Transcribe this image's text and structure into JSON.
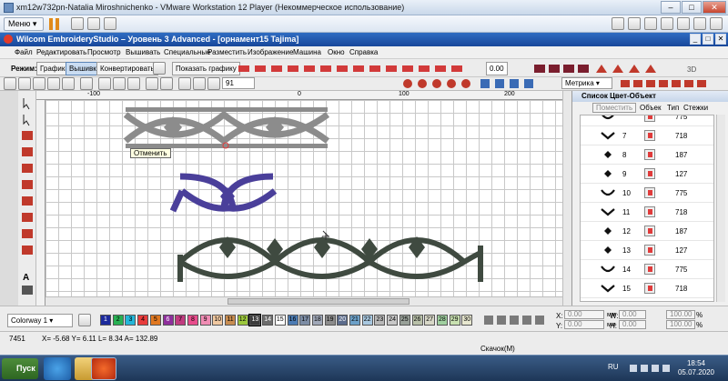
{
  "vmware": {
    "title": "xm12w732pn-Natalia Miroshnichenko - VMware Workstation 12 Player (Некоммерческое использование)",
    "menu_label": "Меню"
  },
  "app": {
    "title": "Wilcom EmbroideryStudio – Уровень 3 Advanced - [орнамент15      Tajima]"
  },
  "menu": {
    "items": [
      "Файл",
      "Редактировать",
      "Просмотр",
      "Вышивать",
      "Специальные",
      "Разместить",
      "Изображение",
      "Машина",
      "Окно",
      "Справка"
    ]
  },
  "toolbar1": {
    "mode_label": "Режим:",
    "mode_graphic": "Графика",
    "mode_embroidery": "Вышивка",
    "convert": "Конвертировать",
    "show_graphic": "Показать графику",
    "value": "0.00",
    "num_3d": "3D"
  },
  "toolbar2": {
    "zoom": "91",
    "units": "Метрика"
  },
  "rulers": {
    "top_labels": [
      "-100",
      "0",
      "100",
      "200"
    ]
  },
  "tooltip": "Отменить",
  "panel": {
    "title": "Список Цвет-Объект",
    "apply_button": "Поместить",
    "headers": [
      "Объек",
      "Тип",
      "Стежки"
    ],
    "rows": [
      {
        "num": "",
        "stitches": "775",
        "shape": "arc"
      },
      {
        "num": "7",
        "stitches": "718",
        "shape": "vee"
      },
      {
        "num": "8",
        "stitches": "187",
        "shape": "dot"
      },
      {
        "num": "9",
        "stitches": "127",
        "shape": "dot"
      },
      {
        "num": "10",
        "stitches": "775",
        "shape": "arc"
      },
      {
        "num": "11",
        "stitches": "718",
        "shape": "vee"
      },
      {
        "num": "12",
        "stitches": "187",
        "shape": "dot"
      },
      {
        "num": "13",
        "stitches": "127",
        "shape": "dot"
      },
      {
        "num": "14",
        "stitches": "775",
        "shape": "arc"
      },
      {
        "num": "15",
        "stitches": "718",
        "shape": "vee"
      }
    ]
  },
  "colorbar": {
    "colorway": "Colorway 1",
    "swatches": [
      {
        "n": "1",
        "c": "#1c2a9c"
      },
      {
        "n": "2",
        "c": "#28b052"
      },
      {
        "n": "3",
        "c": "#24b6d8"
      },
      {
        "n": "4",
        "c": "#e83c3c"
      },
      {
        "n": "5",
        "c": "#e07820"
      },
      {
        "n": "6",
        "c": "#8e2f9c"
      },
      {
        "n": "7",
        "c": "#c03c80"
      },
      {
        "n": "8",
        "c": "#e84c8c"
      },
      {
        "n": "9",
        "c": "#f08cb4"
      },
      {
        "n": "10",
        "c": "#f0c8a0"
      },
      {
        "n": "11",
        "c": "#c88c50"
      },
      {
        "n": "12",
        "c": "#9cc83c"
      },
      {
        "n": "13",
        "c": "#3c3c3c"
      },
      {
        "n": "14",
        "c": "#6c6c6c"
      },
      {
        "n": "15",
        "c": "#ffffff"
      },
      {
        "n": "16",
        "c": "#4c7cb4"
      },
      {
        "n": "17",
        "c": "#7c8ca4"
      },
      {
        "n": "18",
        "c": "#a0a8b8"
      },
      {
        "n": "19",
        "c": "#8c8c8c"
      },
      {
        "n": "20",
        "c": "#5c6c8c"
      },
      {
        "n": "21",
        "c": "#6ca0c8"
      },
      {
        "n": "22",
        "c": "#a8c8e0"
      },
      {
        "n": "23",
        "c": "#b8b8b8"
      },
      {
        "n": "24",
        "c": "#c8c8c8"
      },
      {
        "n": "25",
        "c": "#98a098"
      },
      {
        "n": "26",
        "c": "#b8c0a8"
      },
      {
        "n": "27",
        "c": "#d8d8c8"
      },
      {
        "n": "28",
        "c": "#a0d0a0"
      },
      {
        "n": "29",
        "c": "#c8e0b0"
      },
      {
        "n": "30",
        "c": "#e8e8d0"
      }
    ],
    "fields": {
      "x_label": "X:",
      "y_label": "Y:",
      "w_label": "W:",
      "h_label": "H:",
      "x": "0.00",
      "y": "0.00",
      "w": "0.00",
      "h": "0.00",
      "unit": "мм",
      "pct": "100.00",
      "pct_sign": "%"
    }
  },
  "status": {
    "count": "7451",
    "coords": "X=  -5.68 Y=   6.11 L=   8.34 A= 132.89",
    "message": "Скачок(М)"
  },
  "taskbar": {
    "start": "Пуск",
    "lang": "RU",
    "time": "18:54",
    "date": "05.07.2020"
  }
}
